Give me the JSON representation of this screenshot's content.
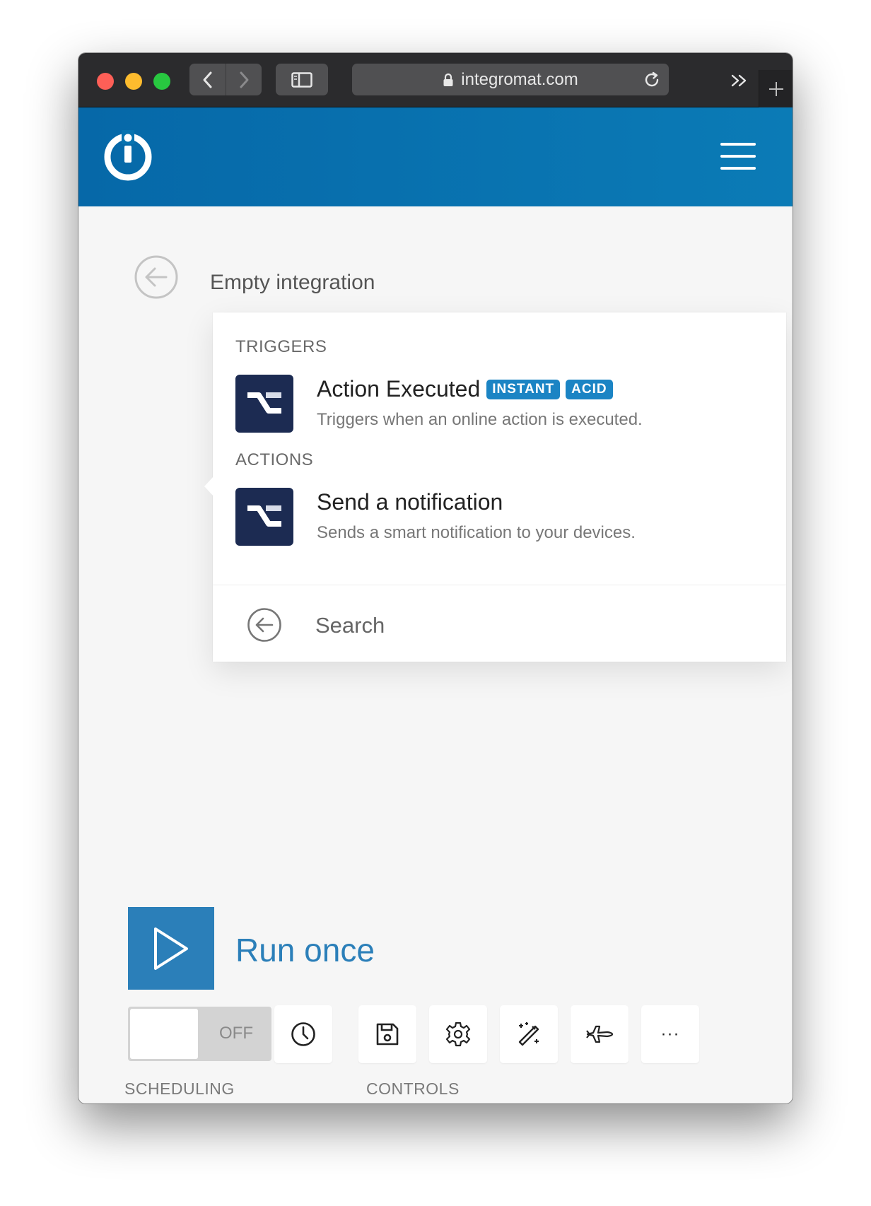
{
  "browser": {
    "url": "integromat.com"
  },
  "scenario": {
    "title": "Empty integration"
  },
  "popup": {
    "triggers_title": "TRIGGERS",
    "actions_title": "ACTIONS",
    "trigger": {
      "title": "Action Executed",
      "badges": [
        "INSTANT",
        "ACID"
      ],
      "description": "Triggers when an online action is executed."
    },
    "action": {
      "title": "Send a notification",
      "description": "Sends a smart notification to your devices."
    },
    "search_label": "Search"
  },
  "run": {
    "label": "Run once"
  },
  "scheduling": {
    "toggle_state": "OFF",
    "label": "SCHEDULING"
  },
  "controls": {
    "label": "CONTROLS",
    "more_glyph": "···"
  },
  "colors": {
    "brand_blue": "#0b7bb6",
    "run_blue": "#2b7fb9",
    "badge_blue": "#1b84c4",
    "module_navy": "#1c2b52"
  }
}
